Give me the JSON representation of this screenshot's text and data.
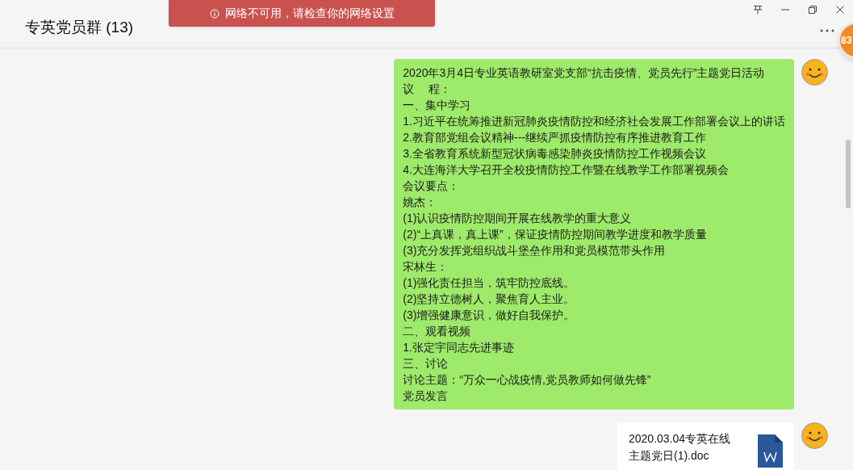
{
  "window": {
    "title": "专英党员群 (13)"
  },
  "toast": {
    "text": "网络不可用，请检查你的网络设置"
  },
  "badge": {
    "count": "83"
  },
  "messages": [
    {
      "kind": "text",
      "lines": [
        "2020年3月4日专业英语教研室党支部“抗击疫情、党员先行”主题党日活动",
        "议　 程：",
        "一、集中学习",
        "1.习近平在统筹推进新冠肺炎疫情防控和经济社会发展工作部署会议上的讲话",
        "2.教育部党组会议精神---继续严抓疫情防控有序推进教育工作",
        "3.全省教育系统新型冠状病毒感染肺炎疫情防控工作视频会议",
        "4.大连海洋大学召开全校疫情防控工作暨在线教学工作部署视频会",
        "会议要点：",
        "姚杰：",
        "(1)认识疫情防控期间开展在线教学的重大意义",
        "(2)“上真课，真上课”，保证疫情防控期间教学进度和教学质量",
        "(3)充分发挥党组织战斗堡垒作用和党员模范带头作用",
        "宋林生：",
        "(1)强化责任担当，筑牢防控底线。",
        "(2)坚持立德树人，聚焦育人主业。",
        "(3)增强健康意识，做好自我保护。",
        "二、观看视频",
        "1.张定宇同志先进事迹",
        "三、讨论",
        "讨论主题：“万众一心战疫情,党员教师如何做先锋”",
        "党员发言"
      ]
    },
    {
      "kind": "file",
      "lines": [
        "2020.03.04专英在线",
        "主题党日(1).doc"
      ]
    }
  ]
}
